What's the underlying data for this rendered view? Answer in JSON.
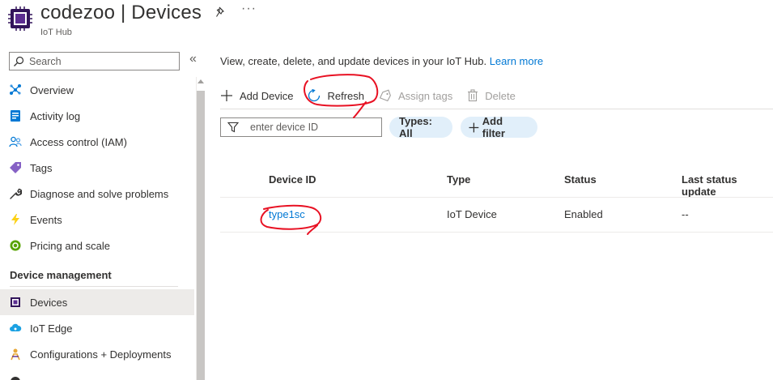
{
  "header": {
    "title": "codezoo | Devices",
    "subtitle": "IoT Hub",
    "pin_icon": "pin-icon",
    "more_label": "···"
  },
  "sidebar": {
    "search_placeholder": "Search",
    "collapse_label": "«",
    "items": [
      {
        "label": "Overview",
        "icon": "overview-icon"
      },
      {
        "label": "Activity log",
        "icon": "activity-log-icon"
      },
      {
        "label": "Access control (IAM)",
        "icon": "people-icon"
      },
      {
        "label": "Tags",
        "icon": "tag-icon"
      },
      {
        "label": "Diagnose and solve problems",
        "icon": "wrench-icon"
      },
      {
        "label": "Events",
        "icon": "lightning-icon"
      },
      {
        "label": "Pricing and scale",
        "icon": "pricing-icon"
      }
    ],
    "section_title": "Device management",
    "section_items": [
      {
        "label": "Devices",
        "icon": "chip-icon",
        "active": true
      },
      {
        "label": "IoT Edge",
        "icon": "cloud-icon"
      },
      {
        "label": "Configurations + Deployments",
        "icon": "configuration-icon"
      }
    ]
  },
  "main": {
    "description": "View, create, delete, and update devices in your IoT Hub.",
    "learn_more": "Learn more",
    "toolbar": {
      "add_device": "Add Device",
      "refresh": "Refresh",
      "assign_tags": "Assign tags",
      "delete": "Delete"
    },
    "filter_placeholder": "enter device ID",
    "types_pill": "Types: All",
    "add_filter": "Add filter",
    "table": {
      "columns": [
        "Device ID",
        "Type",
        "Status",
        "Last status update"
      ],
      "rows": [
        {
          "device_id": "type1sc",
          "type": "IoT Device",
          "status": "Enabled",
          "last_update": "--"
        }
      ]
    }
  },
  "colors": {
    "accent": "#0078d4",
    "pill_bg": "#e1effa",
    "annotation": "#e81123",
    "active_item_bg": "#edebe9"
  }
}
